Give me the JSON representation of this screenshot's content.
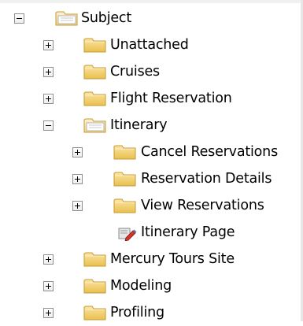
{
  "tree": {
    "root": {
      "label": "Subject",
      "icon": "folder-open-icon",
      "expanded": true
    },
    "items": [
      {
        "label": "Unattached",
        "icon": "folder-icon",
        "expanded": false
      },
      {
        "label": "Cruises",
        "icon": "folder-icon",
        "expanded": false
      },
      {
        "label": "Flight Reservation",
        "icon": "folder-icon",
        "expanded": false
      },
      {
        "label": "Itinerary",
        "icon": "folder-open-icon",
        "expanded": true,
        "children": [
          {
            "label": "Cancel Reservations",
            "icon": "folder-icon",
            "expanded": false
          },
          {
            "label": "Reservation Details",
            "icon": "folder-icon",
            "expanded": false
          },
          {
            "label": "View Reservations",
            "icon": "folder-icon",
            "expanded": false
          },
          {
            "label": "Itinerary Page",
            "icon": "test-page-icon"
          }
        ]
      },
      {
        "label": "Mercury Tours Site",
        "icon": "folder-icon",
        "expanded": false
      },
      {
        "label": "Modeling",
        "icon": "folder-icon",
        "expanded": false
      },
      {
        "label": "Profiling",
        "icon": "folder-icon",
        "expanded": false
      }
    ]
  },
  "colors": {
    "folder_fill": "#f3d177",
    "folder_border": "#c79a2e",
    "expander_border": "#8e8f8f"
  }
}
